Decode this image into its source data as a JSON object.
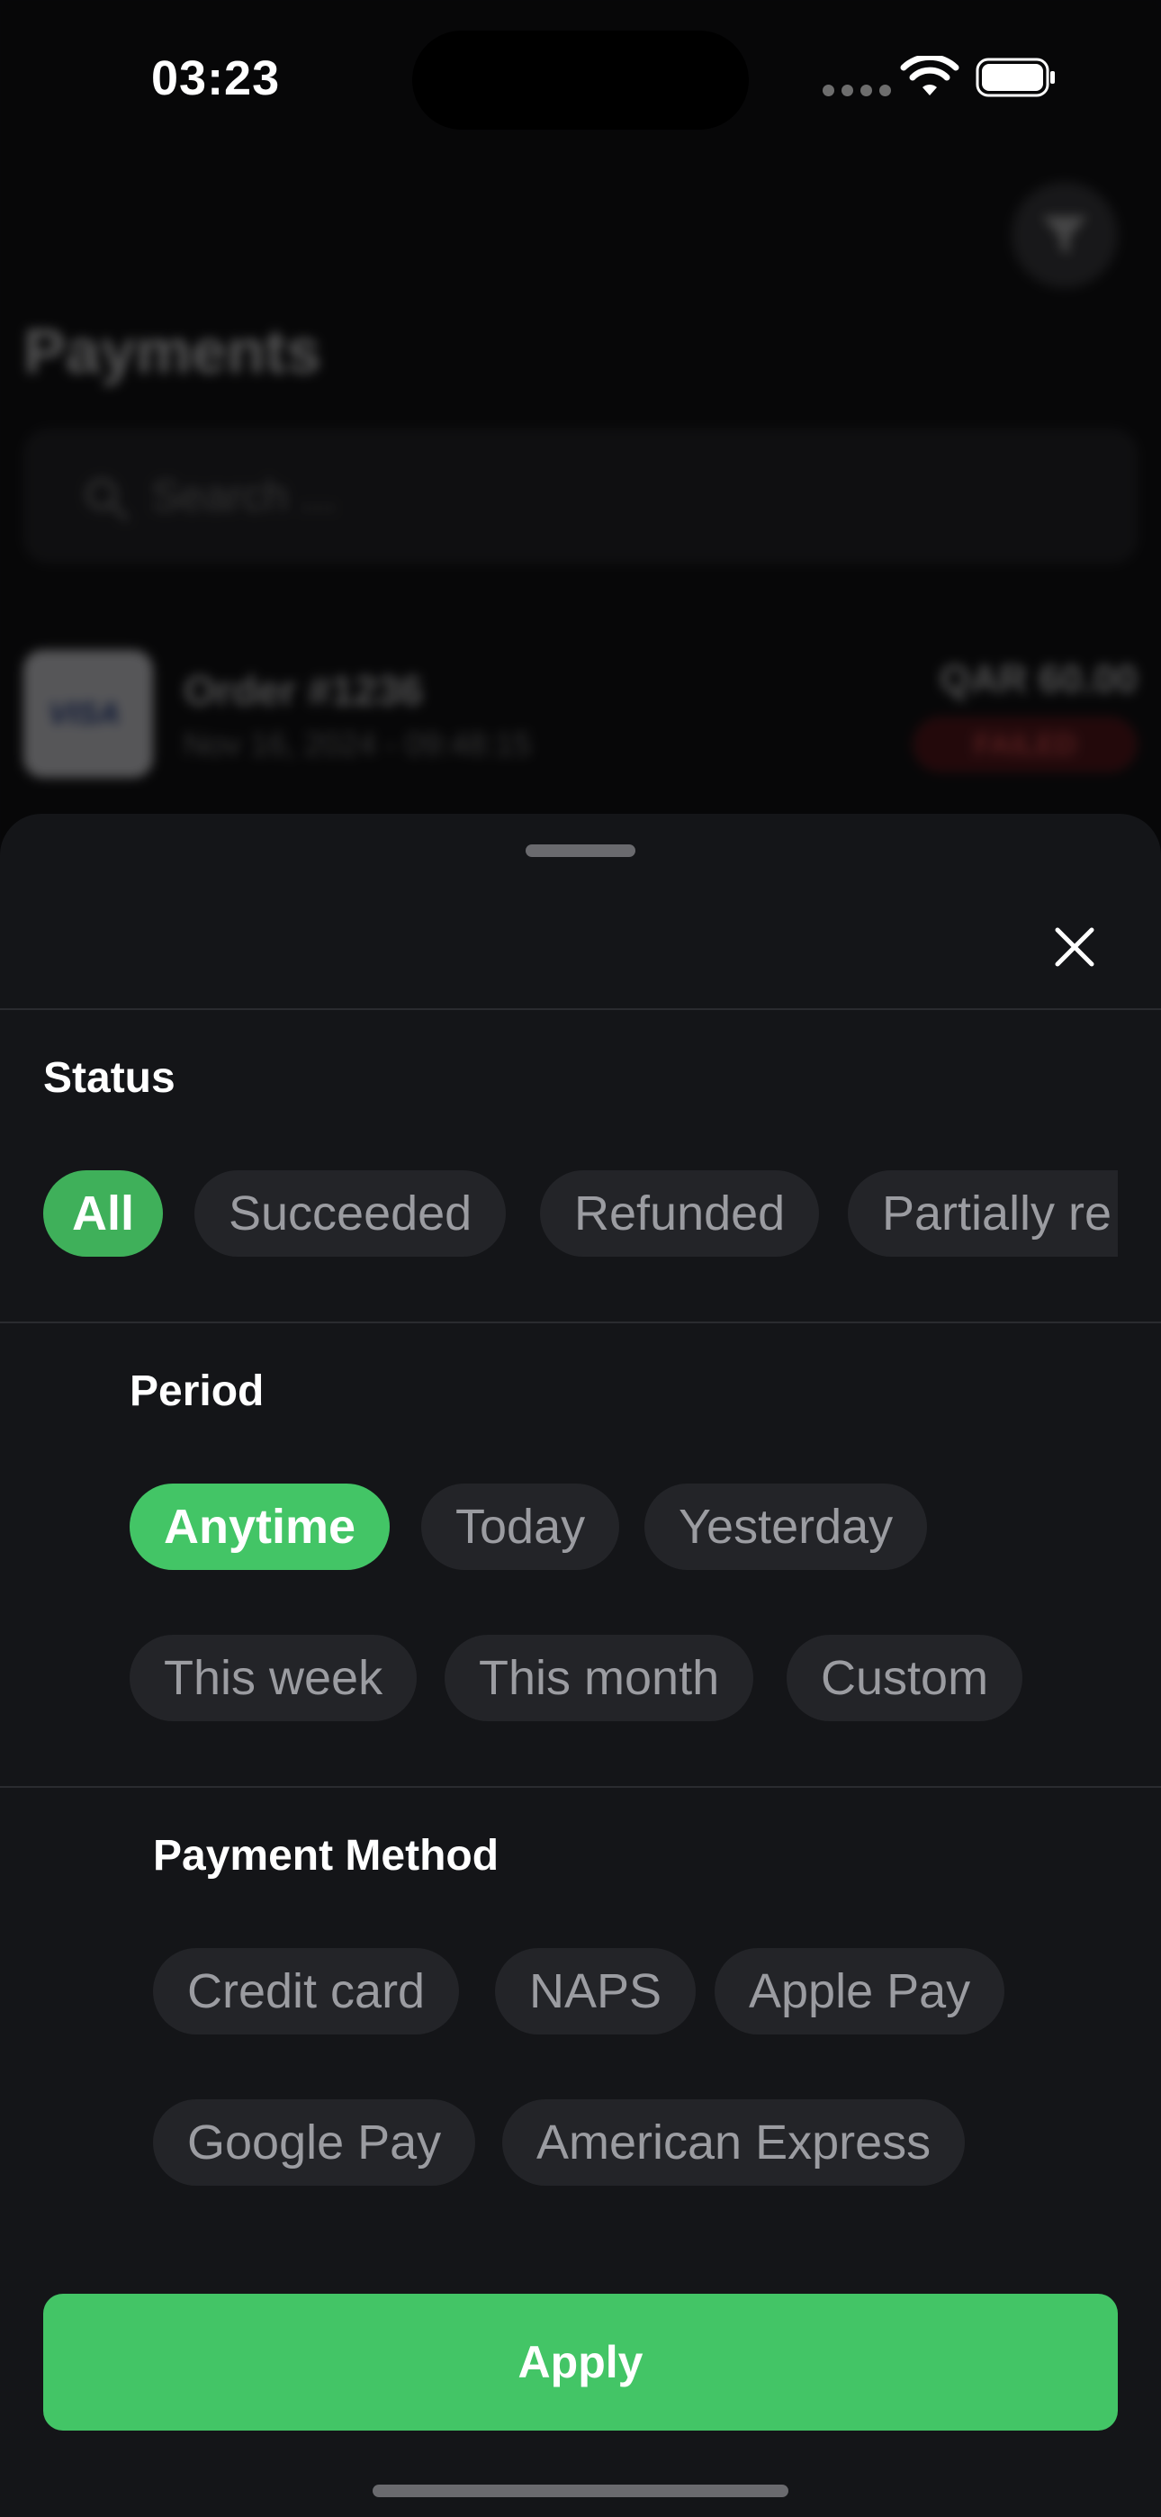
{
  "status_bar": {
    "time": "03:23"
  },
  "background": {
    "title": "Payments",
    "search_placeholder": "Search ...",
    "order": {
      "card_brand": "VISA",
      "title": "Order #1236",
      "date": "Nov 16, 2024 - 09:48:15",
      "amount": "QAR 60.00",
      "status": "FAILED"
    }
  },
  "sheet": {
    "status": {
      "title": "Status",
      "options": [
        "All",
        "Succeeded",
        "Refunded",
        "Partially re"
      ],
      "selected": "All"
    },
    "period": {
      "title": "Period",
      "options": [
        "Anytime",
        "Today",
        "Yesterday",
        "This week",
        "This month",
        "Custom"
      ],
      "selected": "Anytime"
    },
    "payment_method": {
      "title": "Payment Method",
      "options": [
        "Credit card",
        "NAPS",
        "Apple Pay",
        "Google Pay",
        "American Express"
      ]
    },
    "apply_label": "Apply"
  },
  "icons": {
    "close": "close-icon",
    "filter": "filter-icon",
    "search": "search-icon",
    "wifi": "wifi-icon",
    "battery": "battery-icon"
  },
  "colors": {
    "accent": "#43c566",
    "sheet_bg": "#141518",
    "chip_bg": "#232428",
    "failed": "#e24a4a"
  }
}
